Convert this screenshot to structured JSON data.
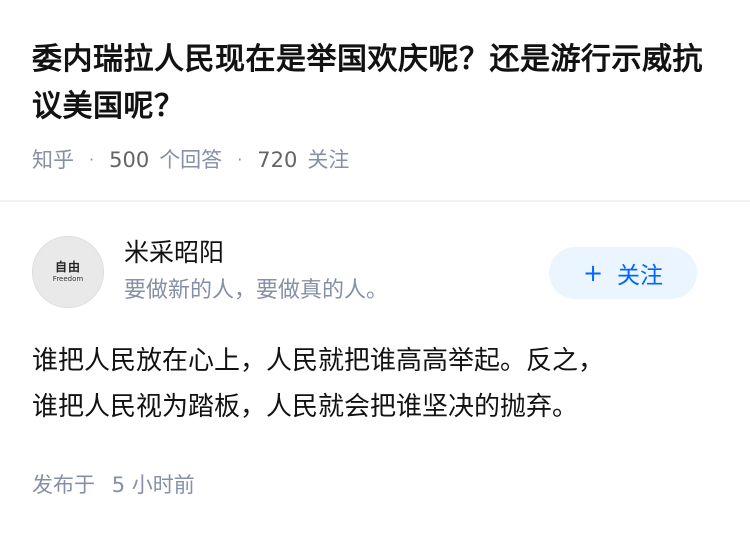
{
  "question": {
    "title": "委内瑞拉人民现在是举国欢庆呢？还是游行示威抗议美国呢？",
    "meta": {
      "site": "知乎",
      "answer_count": "500",
      "answer_label": "个回答",
      "follower_count": "720",
      "follower_label": "关注",
      "separator": "·"
    }
  },
  "author": {
    "avatar_text": "自由",
    "avatar_subtext": "Freedom",
    "name": "米采昭阳",
    "bio": "要做新的人，要做真的人。",
    "follow_label": "关注",
    "follow_icon": "+"
  },
  "answer": {
    "lines": [
      "谁把人民放在心上，人民就把谁高高举起。反之，",
      "谁把人民视为踏板，人民就会把谁坚决的抛弃。"
    ],
    "time_prefix": "发布于",
    "time_value": "5 小时前"
  },
  "colors": {
    "title": "#121212",
    "meta": "#8590a6",
    "follow_bg": "#ebf5ff",
    "follow_text": "#0066ff",
    "divider": "#f0f2f7"
  }
}
